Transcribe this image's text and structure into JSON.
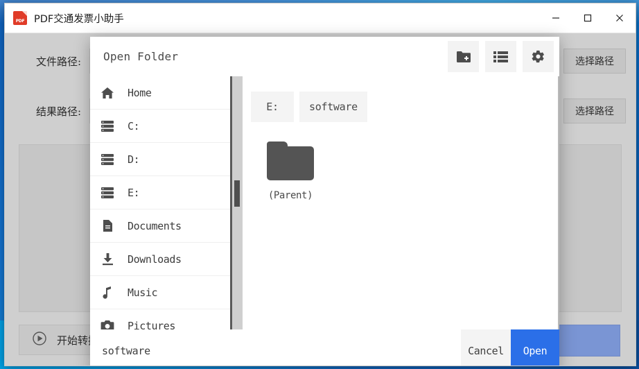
{
  "window": {
    "title": "PDF交通发票小助手",
    "app_icon": "pdf-file-icon",
    "icon_text": "PDF",
    "controls": {
      "minimize": "minimize-icon",
      "maximize": "maximize-icon",
      "close": "close-icon"
    }
  },
  "app": {
    "fields": [
      {
        "label": "文件路径:",
        "value": "",
        "button": "选择路径"
      },
      {
        "label": "结果路径:",
        "value": "",
        "button": "选择路径"
      }
    ],
    "start_button": {
      "icon": "play-circle-icon",
      "label": "开始转换"
    },
    "progress_color": "#7a95d4",
    "log_value": ""
  },
  "dialog": {
    "title": "Open Folder",
    "tools": [
      {
        "name": "new-folder-icon",
        "label": ""
      },
      {
        "name": "list-view-icon",
        "label": ""
      },
      {
        "name": "settings-gear-icon",
        "label": ""
      }
    ],
    "places": [
      {
        "icon": "home-icon",
        "label": "Home"
      },
      {
        "icon": "drive-icon",
        "label": "C:"
      },
      {
        "icon": "drive-icon",
        "label": "D:"
      },
      {
        "icon": "drive-icon",
        "label": "E:"
      },
      {
        "icon": "document-icon",
        "label": "Documents"
      },
      {
        "icon": "download-icon",
        "label": "Downloads"
      },
      {
        "icon": "music-note-icon",
        "label": "Music"
      },
      {
        "icon": "camera-icon",
        "label": "Pictures"
      }
    ],
    "breadcrumb": [
      "E:",
      "software"
    ],
    "files": [
      {
        "icon": "folder-icon",
        "name": "(Parent)"
      }
    ],
    "footer": {
      "filename": "software",
      "cancel_label": "Cancel",
      "open_label": "Open",
      "open_color": "#2b6fe8"
    }
  }
}
